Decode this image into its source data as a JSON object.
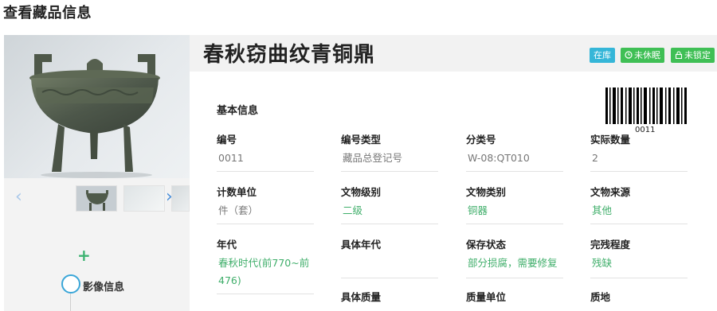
{
  "page": {
    "title": "查看藏品信息"
  },
  "relic": {
    "name": "春秋窃曲纹青铜鼎"
  },
  "badges": {
    "instock": "在库",
    "dormant": "未休眠",
    "unlocked": "未锁定"
  },
  "barcode": {
    "number": "0011"
  },
  "section": {
    "basic_info": "基本信息"
  },
  "fields": {
    "serial_no": {
      "label": "编号",
      "value": "0011"
    },
    "serial_type": {
      "label": "编号类型",
      "value": "藏品总登记号"
    },
    "category_no": {
      "label": "分类号",
      "value": "W-08:QT010"
    },
    "actual_qty": {
      "label": "实际数量",
      "value": "2"
    },
    "count_unit": {
      "label": "计数单位",
      "value": "件（套）"
    },
    "relic_level": {
      "label": "文物级别",
      "value": "二级"
    },
    "relic_category": {
      "label": "文物类别",
      "value": "铜器"
    },
    "relic_source": {
      "label": "文物来源",
      "value": "其他"
    },
    "era": {
      "label": "年代",
      "value": "春秋时代(前770~前476)"
    },
    "specific_era": {
      "label": "具体年代",
      "value": ""
    },
    "preservation": {
      "label": "保存状态",
      "value": "部分损腐，需要修复"
    },
    "completeness": {
      "label": "完残程度",
      "value": "残缺"
    },
    "specific_quality": {
      "label": "具体质量",
      "value": ""
    },
    "quality_unit": {
      "label": "质量单位",
      "value": ""
    },
    "texture": {
      "label": "质地",
      "value": ""
    }
  },
  "gallery": {
    "prev_icon": "chevron-left-icon",
    "next_icon": "chevron-right-icon",
    "add_icon": "plus-icon"
  },
  "timeline": {
    "label": "影像信息"
  },
  "colors": {
    "accent_green": "#3fae6a",
    "badge_blue": "#35b6d8",
    "badge_green": "#3fbf55"
  }
}
